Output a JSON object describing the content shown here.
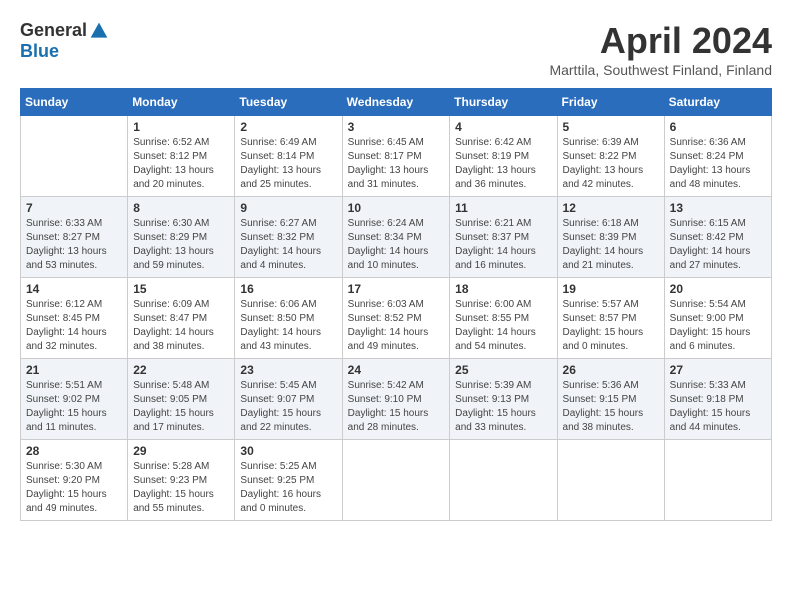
{
  "header": {
    "logo_general": "General",
    "logo_blue": "Blue",
    "month_title": "April 2024",
    "location": "Marttila, Southwest Finland, Finland"
  },
  "days_of_week": [
    "Sunday",
    "Monday",
    "Tuesday",
    "Wednesday",
    "Thursday",
    "Friday",
    "Saturday"
  ],
  "weeks": [
    [
      {
        "day": "",
        "sunrise": "",
        "sunset": "",
        "daylight": ""
      },
      {
        "day": "1",
        "sunrise": "Sunrise: 6:52 AM",
        "sunset": "Sunset: 8:12 PM",
        "daylight": "Daylight: 13 hours and 20 minutes."
      },
      {
        "day": "2",
        "sunrise": "Sunrise: 6:49 AM",
        "sunset": "Sunset: 8:14 PM",
        "daylight": "Daylight: 13 hours and 25 minutes."
      },
      {
        "day": "3",
        "sunrise": "Sunrise: 6:45 AM",
        "sunset": "Sunset: 8:17 PM",
        "daylight": "Daylight: 13 hours and 31 minutes."
      },
      {
        "day": "4",
        "sunrise": "Sunrise: 6:42 AM",
        "sunset": "Sunset: 8:19 PM",
        "daylight": "Daylight: 13 hours and 36 minutes."
      },
      {
        "day": "5",
        "sunrise": "Sunrise: 6:39 AM",
        "sunset": "Sunset: 8:22 PM",
        "daylight": "Daylight: 13 hours and 42 minutes."
      },
      {
        "day": "6",
        "sunrise": "Sunrise: 6:36 AM",
        "sunset": "Sunset: 8:24 PM",
        "daylight": "Daylight: 13 hours and 48 minutes."
      }
    ],
    [
      {
        "day": "7",
        "sunrise": "Sunrise: 6:33 AM",
        "sunset": "Sunset: 8:27 PM",
        "daylight": "Daylight: 13 hours and 53 minutes."
      },
      {
        "day": "8",
        "sunrise": "Sunrise: 6:30 AM",
        "sunset": "Sunset: 8:29 PM",
        "daylight": "Daylight: 13 hours and 59 minutes."
      },
      {
        "day": "9",
        "sunrise": "Sunrise: 6:27 AM",
        "sunset": "Sunset: 8:32 PM",
        "daylight": "Daylight: 14 hours and 4 minutes."
      },
      {
        "day": "10",
        "sunrise": "Sunrise: 6:24 AM",
        "sunset": "Sunset: 8:34 PM",
        "daylight": "Daylight: 14 hours and 10 minutes."
      },
      {
        "day": "11",
        "sunrise": "Sunrise: 6:21 AM",
        "sunset": "Sunset: 8:37 PM",
        "daylight": "Daylight: 14 hours and 16 minutes."
      },
      {
        "day": "12",
        "sunrise": "Sunrise: 6:18 AM",
        "sunset": "Sunset: 8:39 PM",
        "daylight": "Daylight: 14 hours and 21 minutes."
      },
      {
        "day": "13",
        "sunrise": "Sunrise: 6:15 AM",
        "sunset": "Sunset: 8:42 PM",
        "daylight": "Daylight: 14 hours and 27 minutes."
      }
    ],
    [
      {
        "day": "14",
        "sunrise": "Sunrise: 6:12 AM",
        "sunset": "Sunset: 8:45 PM",
        "daylight": "Daylight: 14 hours and 32 minutes."
      },
      {
        "day": "15",
        "sunrise": "Sunrise: 6:09 AM",
        "sunset": "Sunset: 8:47 PM",
        "daylight": "Daylight: 14 hours and 38 minutes."
      },
      {
        "day": "16",
        "sunrise": "Sunrise: 6:06 AM",
        "sunset": "Sunset: 8:50 PM",
        "daylight": "Daylight: 14 hours and 43 minutes."
      },
      {
        "day": "17",
        "sunrise": "Sunrise: 6:03 AM",
        "sunset": "Sunset: 8:52 PM",
        "daylight": "Daylight: 14 hours and 49 minutes."
      },
      {
        "day": "18",
        "sunrise": "Sunrise: 6:00 AM",
        "sunset": "Sunset: 8:55 PM",
        "daylight": "Daylight: 14 hours and 54 minutes."
      },
      {
        "day": "19",
        "sunrise": "Sunrise: 5:57 AM",
        "sunset": "Sunset: 8:57 PM",
        "daylight": "Daylight: 15 hours and 0 minutes."
      },
      {
        "day": "20",
        "sunrise": "Sunrise: 5:54 AM",
        "sunset": "Sunset: 9:00 PM",
        "daylight": "Daylight: 15 hours and 6 minutes."
      }
    ],
    [
      {
        "day": "21",
        "sunrise": "Sunrise: 5:51 AM",
        "sunset": "Sunset: 9:02 PM",
        "daylight": "Daylight: 15 hours and 11 minutes."
      },
      {
        "day": "22",
        "sunrise": "Sunrise: 5:48 AM",
        "sunset": "Sunset: 9:05 PM",
        "daylight": "Daylight: 15 hours and 17 minutes."
      },
      {
        "day": "23",
        "sunrise": "Sunrise: 5:45 AM",
        "sunset": "Sunset: 9:07 PM",
        "daylight": "Daylight: 15 hours and 22 minutes."
      },
      {
        "day": "24",
        "sunrise": "Sunrise: 5:42 AM",
        "sunset": "Sunset: 9:10 PM",
        "daylight": "Daylight: 15 hours and 28 minutes."
      },
      {
        "day": "25",
        "sunrise": "Sunrise: 5:39 AM",
        "sunset": "Sunset: 9:13 PM",
        "daylight": "Daylight: 15 hours and 33 minutes."
      },
      {
        "day": "26",
        "sunrise": "Sunrise: 5:36 AM",
        "sunset": "Sunset: 9:15 PM",
        "daylight": "Daylight: 15 hours and 38 minutes."
      },
      {
        "day": "27",
        "sunrise": "Sunrise: 5:33 AM",
        "sunset": "Sunset: 9:18 PM",
        "daylight": "Daylight: 15 hours and 44 minutes."
      }
    ],
    [
      {
        "day": "28",
        "sunrise": "Sunrise: 5:30 AM",
        "sunset": "Sunset: 9:20 PM",
        "daylight": "Daylight: 15 hours and 49 minutes."
      },
      {
        "day": "29",
        "sunrise": "Sunrise: 5:28 AM",
        "sunset": "Sunset: 9:23 PM",
        "daylight": "Daylight: 15 hours and 55 minutes."
      },
      {
        "day": "30",
        "sunrise": "Sunrise: 5:25 AM",
        "sunset": "Sunset: 9:25 PM",
        "daylight": "Daylight: 16 hours and 0 minutes."
      },
      {
        "day": "",
        "sunrise": "",
        "sunset": "",
        "daylight": ""
      },
      {
        "day": "",
        "sunrise": "",
        "sunset": "",
        "daylight": ""
      },
      {
        "day": "",
        "sunrise": "",
        "sunset": "",
        "daylight": ""
      },
      {
        "day": "",
        "sunrise": "",
        "sunset": "",
        "daylight": ""
      }
    ]
  ]
}
